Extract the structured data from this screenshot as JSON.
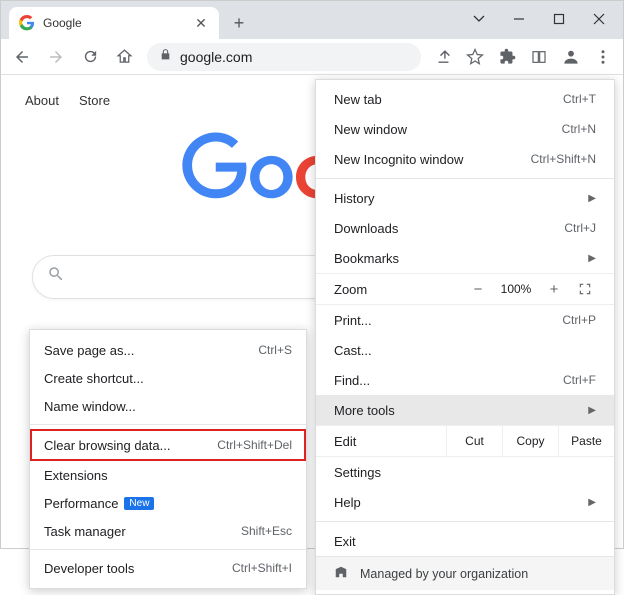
{
  "titlebar": {
    "tab_title": "Google",
    "new_tab_symbol": "+"
  },
  "toolbar": {
    "url": "google.com"
  },
  "nav": {
    "about": "About",
    "store": "Store"
  },
  "menu": {
    "new_tab": "New tab",
    "new_tab_sc": "Ctrl+T",
    "new_window": "New window",
    "new_window_sc": "Ctrl+N",
    "incognito": "New Incognito window",
    "incognito_sc": "Ctrl+Shift+N",
    "history": "History",
    "downloads": "Downloads",
    "downloads_sc": "Ctrl+J",
    "bookmarks": "Bookmarks",
    "zoom_label": "Zoom",
    "zoom_value": "100%",
    "print": "Print...",
    "print_sc": "Ctrl+P",
    "cast": "Cast...",
    "find": "Find...",
    "find_sc": "Ctrl+F",
    "more_tools": "More tools",
    "edit": "Edit",
    "cut": "Cut",
    "copy": "Copy",
    "paste": "Paste",
    "settings": "Settings",
    "help": "Help",
    "exit": "Exit",
    "managed": "Managed by your organization"
  },
  "submenu": {
    "save_page": "Save page as...",
    "save_page_sc": "Ctrl+S",
    "create_shortcut": "Create shortcut...",
    "name_window": "Name window...",
    "clear_data": "Clear browsing data...",
    "clear_data_sc": "Ctrl+Shift+Del",
    "extensions": "Extensions",
    "performance": "Performance",
    "performance_badge": "New",
    "task_manager": "Task manager",
    "task_manager_sc": "Shift+Esc",
    "dev_tools": "Developer tools",
    "dev_tools_sc": "Ctrl+Shift+I"
  }
}
